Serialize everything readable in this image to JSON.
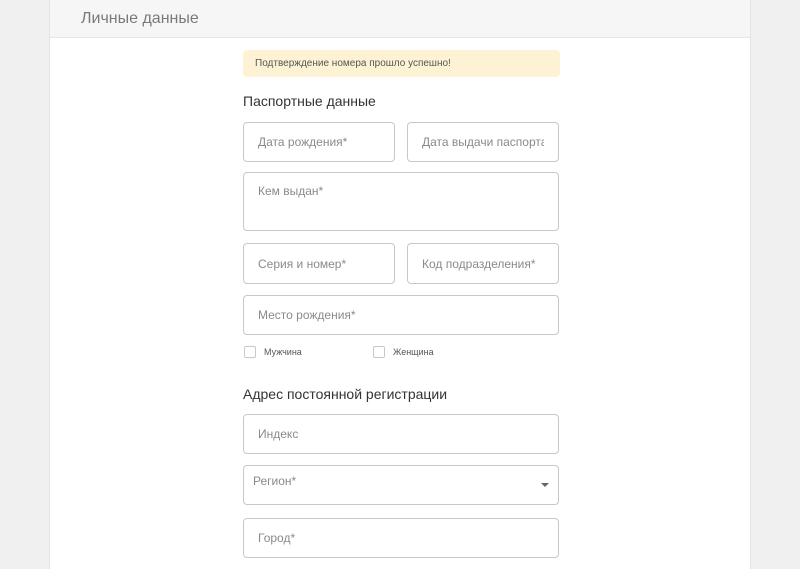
{
  "header": {
    "title": "Личные данные"
  },
  "alert": {
    "text": "Подтверждение номера прошло успешно!"
  },
  "passport": {
    "title": "Паспортные данные",
    "fields": {
      "birth_date": "Дата рождения*",
      "issue_date": "Дата выдачи паспорта*",
      "issued_by": "Кем выдан*",
      "series_number": "Серия и номер*",
      "division_code": "Код подразделения*",
      "birth_place": "Место рождения*"
    },
    "gender": {
      "male": "Мужчина",
      "female": "Женщина"
    }
  },
  "address": {
    "title": "Адрес постоянной регистрации",
    "fields": {
      "index": "Индекс",
      "region": "Регион*",
      "city": "Город*"
    }
  },
  "icons": {
    "select_caret": "caret-down-icon"
  }
}
